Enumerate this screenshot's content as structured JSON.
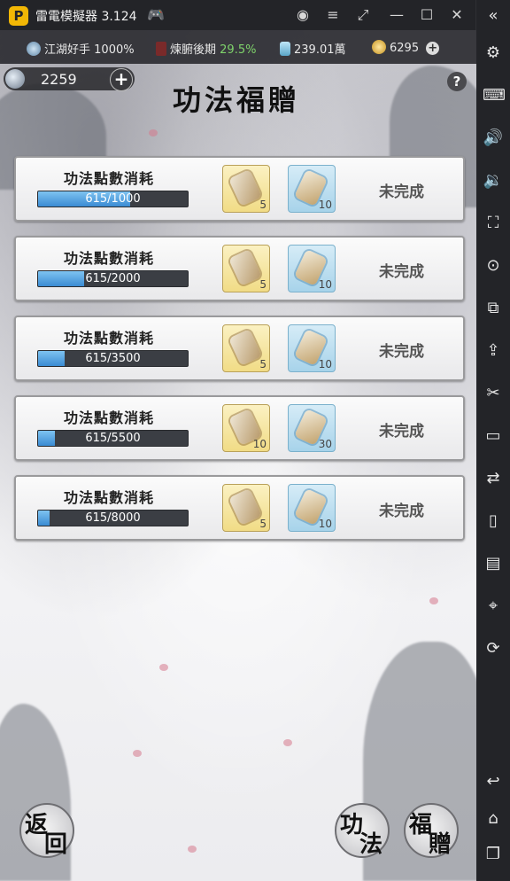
{
  "emulator": {
    "title": "雷電模擬器 3.124",
    "logo": "P"
  },
  "resources": {
    "rank": {
      "label": "江湖好手",
      "value": "1000%"
    },
    "stage": {
      "label": "煉腑後期",
      "value": "29.5%"
    },
    "silver": "239.01萬",
    "gold": "6295"
  },
  "currency": {
    "value": "2259"
  },
  "page": {
    "title": "功法福贈"
  },
  "tasks": [
    {
      "label": "功法點數消耗",
      "progress": "615/1000",
      "fill": 0.615,
      "reward1": "5",
      "reward2": "10",
      "status": "未完成"
    },
    {
      "label": "功法點數消耗",
      "progress": "615/2000",
      "fill": 0.3075,
      "reward1": "5",
      "reward2": "10",
      "status": "未完成"
    },
    {
      "label": "功法點數消耗",
      "progress": "615/3500",
      "fill": 0.176,
      "reward1": "5",
      "reward2": "10",
      "status": "未完成"
    },
    {
      "label": "功法點數消耗",
      "progress": "615/5500",
      "fill": 0.112,
      "reward1": "10",
      "reward2": "30",
      "status": "未完成"
    },
    {
      "label": "功法點數消耗",
      "progress": "615/8000",
      "fill": 0.077,
      "reward1": "5",
      "reward2": "10",
      "status": "未完成"
    }
  ],
  "buttons": {
    "back": [
      "返",
      "回"
    ],
    "skill": [
      "功",
      "法"
    ],
    "gift": [
      "福",
      "贈"
    ]
  },
  "colors": {
    "accent_green": "#7fd36b",
    "progress_blue": "#3a8bd3",
    "emulator_logo": "#f2b705"
  }
}
